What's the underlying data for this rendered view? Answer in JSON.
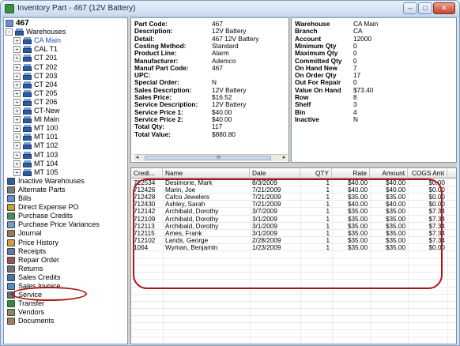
{
  "window": {
    "title": "Inventory Part - 467 (12V Battery)",
    "controls": {
      "minimize": "–",
      "maximize": "□",
      "close": "✕"
    }
  },
  "tree": {
    "root": "467",
    "warehouses_label": "Warehouses",
    "warehouses": [
      "CA Main",
      "CAL T1",
      "CT 201",
      "CT 202",
      "CT 203",
      "CT 204",
      "CT 205",
      "CT 206",
      "CT-New",
      "MI Main",
      "MT 100",
      "MT 101",
      "MT 102",
      "MT 103",
      "MT 104",
      "MT 105"
    ],
    "selected_warehouse": "CA Main",
    "items": [
      {
        "label": "Inactive Warehouses",
        "icon": "warehouse-icon"
      },
      {
        "label": "Alternate Parts",
        "icon": "parts-icon"
      },
      {
        "label": "Bills",
        "icon": "bill-icon"
      },
      {
        "label": "Direct Expense PO",
        "icon": "po-icon"
      },
      {
        "label": "Purchase Credits",
        "icon": "credit-icon"
      },
      {
        "label": "Purchase Price Variances",
        "icon": "variance-icon"
      },
      {
        "label": "Journal",
        "icon": "journal-icon"
      },
      {
        "label": "Price History",
        "icon": "history-icon"
      },
      {
        "label": "Receipts",
        "icon": "receipt-icon"
      },
      {
        "label": "Repair Order",
        "icon": "repair-icon"
      },
      {
        "label": "Returns",
        "icon": "return-icon"
      },
      {
        "label": "Sales Credits",
        "icon": "sales-credit-icon"
      },
      {
        "label": "Sales Invoice",
        "icon": "invoice-icon"
      },
      {
        "label": "Service",
        "icon": "service-icon"
      },
      {
        "label": "Transfer",
        "icon": "transfer-icon"
      },
      {
        "label": "Vendors",
        "icon": "vendor-icon"
      },
      {
        "label": "Documents",
        "icon": "documents-icon"
      }
    ]
  },
  "part_details": [
    {
      "label": "Part Code:",
      "value": "467"
    },
    {
      "label": "Description:",
      "value": "12V Battery"
    },
    {
      "label": "Detail:",
      "value": "467 12V Battery"
    },
    {
      "label": "Costing Method:",
      "value": "Standard"
    },
    {
      "label": "Product Line:",
      "value": "Alarm"
    },
    {
      "label": "Manufacturer:",
      "value": "Ademco"
    },
    {
      "label": "Manuf Part Code:",
      "value": "467"
    },
    {
      "label": "UPC:",
      "value": ""
    },
    {
      "label": "Special Order:",
      "value": "N"
    },
    {
      "label": "Sales Description:",
      "value": "12V Battery"
    },
    {
      "label": "Sales Price:",
      "value": "$16.52"
    },
    {
      "label": "Service Description:",
      "value": "12V Battery"
    },
    {
      "label": "Service Price 1:",
      "value": "$40.00"
    },
    {
      "label": "Service Price 2:",
      "value": "$40.00"
    },
    {
      "label": "Total Qty:",
      "value": "117"
    },
    {
      "label": "Total Value:",
      "value": "$880.80"
    }
  ],
  "warehouse_details": [
    {
      "label": "Warehouse",
      "value": "CA Main"
    },
    {
      "label": "Branch",
      "value": "CA"
    },
    {
      "label": "Account",
      "value": "12000"
    },
    {
      "label": "Minimum Qty",
      "value": "0"
    },
    {
      "label": "Maximum Qty",
      "value": "0"
    },
    {
      "label": "Committed Qty",
      "value": "0"
    },
    {
      "label": "On Hand New",
      "value": "7"
    },
    {
      "label": "On Order Qty",
      "value": "17"
    },
    {
      "label": "Out For Repair",
      "value": "0"
    },
    {
      "label": "Value On Hand",
      "value": "$73.40"
    },
    {
      "label": "Row",
      "value": "8"
    },
    {
      "label": "Shelf",
      "value": "3"
    },
    {
      "label": "Bin",
      "value": "4"
    },
    {
      "label": "Inactive",
      "value": "N"
    }
  ],
  "scroll": {
    "left_arrow": "◂",
    "right_arrow": "▸",
    "grip": "III"
  },
  "grid": {
    "columns": [
      "Credi...",
      "Name",
      "Date",
      "QTY",
      "Rate",
      "Amount",
      "COGS Amt"
    ],
    "rows": [
      [
        "712534",
        "Desimone, Mark",
        "8/3/2009",
        "1",
        "$40.00",
        "$40.00",
        "$0.00"
      ],
      [
        "712426",
        "Marin, Joe",
        "7/21/2009",
        "1",
        "$40.00",
        "$40.00",
        "$0.00"
      ],
      [
        "712428",
        "Cafco Jewelers",
        "7/21/2009",
        "1",
        "$35.00",
        "$35.00",
        "$0.00"
      ],
      [
        "712430",
        "Ashley, Sarah",
        "7/21/2009",
        "1",
        "$40.00",
        "$40.00",
        "$0.00"
      ],
      [
        "712142",
        "Archibald, Dorothy",
        "3/7/2009",
        "1",
        "$35.00",
        "$35.00",
        "$7.34"
      ],
      [
        "712109",
        "Archibald, Dorothy",
        "3/1/2009",
        "1",
        "$35.00",
        "$35.00",
        "$7.34"
      ],
      [
        "712113",
        "Archibald, Dorothy",
        "3/1/2009",
        "1",
        "$35.00",
        "$35.00",
        "$7.34"
      ],
      [
        "712115",
        "Ames, Frank",
        "3/1/2009",
        "1",
        "$35.00",
        "$35.00",
        "$7.34"
      ],
      [
        "712102",
        "Lands, George",
        "2/28/2009",
        "1",
        "$35.00",
        "$35.00",
        "$7.34"
      ],
      [
        "1064",
        "Wyman, Benjamin",
        "1/23/2009",
        "1",
        "$35.00",
        "$35.00",
        "$0.00"
      ]
    ]
  },
  "colors": {
    "accent": "#1e54b4",
    "highlight_circle": "#b01515"
  }
}
